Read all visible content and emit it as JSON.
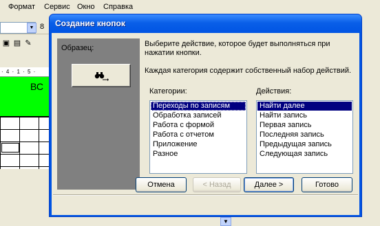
{
  "background_app": {
    "menu": [
      "Формат",
      "Сервис",
      "Окно",
      "Справка"
    ],
    "font_size_fragment": "8",
    "ruler_text": "· 4 · 1 · 5 ·",
    "section_text": "ВС"
  },
  "dialog": {
    "title": "Создание кнопок",
    "sample_label": "Образец:",
    "description_1": "Выберите действие, которое будет выполняться при нажатии кнопки.",
    "description_2": "Каждая категория содержит собственный набор действий.",
    "categories_label": "Категории:",
    "actions_label": "Действия:",
    "categories": [
      "Переходы по записям",
      "Обработка записей",
      "Работа с формой",
      "Работа с отчетом",
      "Приложение",
      "Разное"
    ],
    "selected_category": "Переходы по записям",
    "actions": [
      "Найти далее",
      "Найти запись",
      "Первая запись",
      "Последняя запись",
      "Предыдущая запись",
      "Следующая запись"
    ],
    "selected_action": "Найти далее",
    "buttons": {
      "cancel": "Отмена",
      "back": "< Назад",
      "next": "Далее >",
      "finish": "Готово"
    }
  },
  "colors": {
    "title_bar": "#0054e3",
    "selection": "#000080",
    "form_section": "#00ff00"
  }
}
